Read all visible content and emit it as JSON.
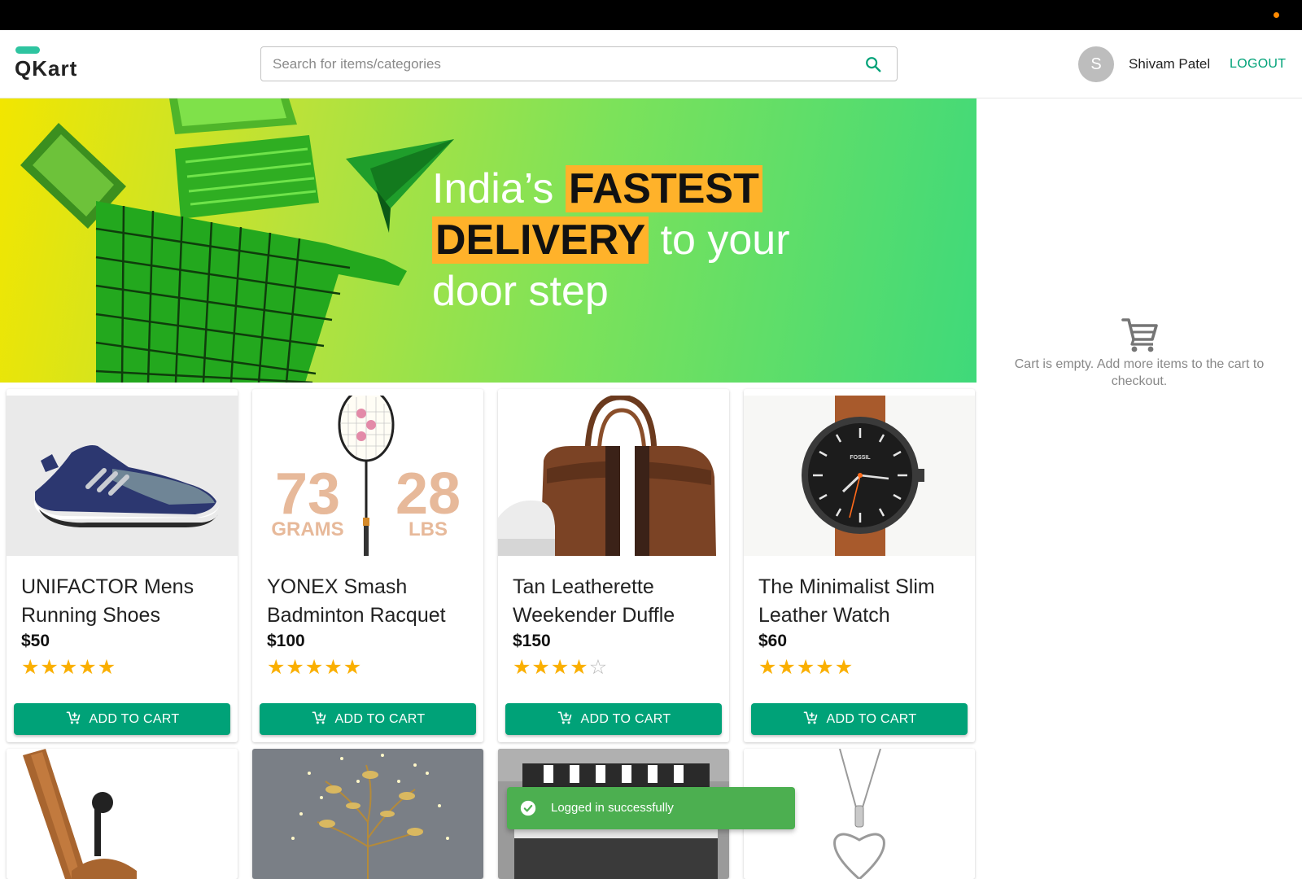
{
  "header": {
    "logo_text": "QKart",
    "search_placeholder": "Search for items/categories",
    "user_initial": "S",
    "username": "Shivam Patel",
    "logout_label": "LOGOUT"
  },
  "banner": {
    "line1_plain": "India’s ",
    "line1_highlight": "FASTEST",
    "line2_highlight": "DELIVERY",
    "line2_plain": " to your",
    "line3": "door step"
  },
  "cart": {
    "empty_message": "Cart is empty. Add more items to the cart to checkout."
  },
  "products": [
    {
      "name": "UNIFACTOR Mens Running Shoes",
      "price": "$50",
      "rating": 5,
      "button": "ADD TO CART"
    },
    {
      "name": "YONEX Smash Badminton Racquet",
      "price": "$100",
      "rating": 5,
      "button": "ADD TO CART",
      "image_text": [
        "73",
        "GRAMS",
        "28",
        "LBS"
      ]
    },
    {
      "name": "Tan Leatherette Weekender Duffle",
      "price": "$150",
      "rating": 4,
      "button": "ADD TO CART"
    },
    {
      "name": "The Minimalist Slim Leather Watch",
      "price": "$60",
      "rating": 5,
      "button": "ADD TO CART",
      "image_text": [
        "FOSSIL"
      ]
    }
  ],
  "toast": {
    "message": "Logged in successfully"
  },
  "colors": {
    "primary": "#00a278",
    "star": "#faaf00",
    "toast": "#4caf50",
    "highlight": "#ffb22a"
  }
}
